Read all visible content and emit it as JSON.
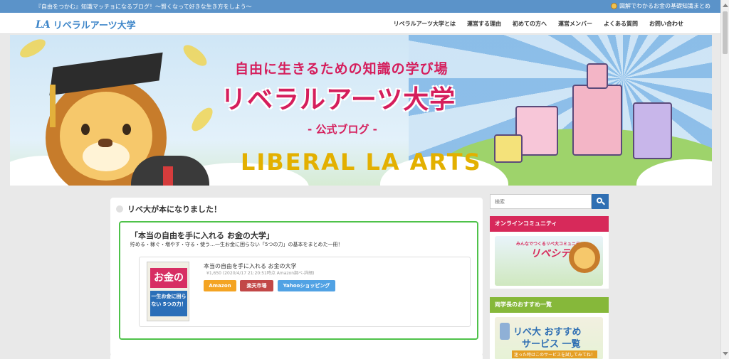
{
  "topbar": {
    "tagline": "『自由をつかむ』知識マッチョになるブログ！〜賢くなって好きな生き方をしよう〜",
    "right_link": "図解でわかるお金の基礎知識まとめ"
  },
  "header": {
    "logo_mark": "LA",
    "logo_text": "リベラルアーツ大学",
    "nav": [
      "リベラルアーツ大学とは",
      "運営する理由",
      "初めての方へ",
      "運営メンバー",
      "よくある質問",
      "お問い合わせ"
    ]
  },
  "hero": {
    "subtitle": "自由に生きるための知識の学び場",
    "title": "リベラルアーツ大学",
    "blog": "- 公式ブログ -",
    "brand": "LIBERAL LA ARTS"
  },
  "main": {
    "heading": "リベ大が本になりました！",
    "book_title": "「本当の自由を手に入れる お金の大学」",
    "book_desc": "貯める・稼ぐ・増やす・守る・使う…一生お金に困らない「5つの力」の基本をまとめた一冊！",
    "cover_title": "お金の大学",
    "cover_sub": "一生お金に困らない 5つの力！",
    "product_name": "本当の自由を手に入れる お金の大学",
    "product_price": "¥1,650 (2020/4/17 21:20:51時点 Amazon調べ-詳細)",
    "buttons": {
      "amazon": "Amazon",
      "rakuten": "楽天市場",
      "yahoo": "Yahooショッピング"
    }
  },
  "sidebar": {
    "search_placeholder": "検索",
    "widget1_title": "オンラインコミュニティ",
    "widget1_banner_sub": "みんなでつくるリベ大コミュニティ",
    "widget1_banner_logo": "リベシティ",
    "widget2_title": "両学長のおすすめ一覧",
    "widget2_banner_line1": "リベ大 おすすめ",
    "widget2_banner_line2": "サービス 一覧",
    "widget2_banner_line3": "迷った時はこのサービスを試してみてね！"
  },
  "colors": {
    "topbar": "#5b93c9",
    "brand_blue": "#3e86c9",
    "hero_pink": "#d51e5c",
    "hero_gold": "#e3b000",
    "green_border": "#4fc24a",
    "widget_pink": "#d7295a",
    "widget_green": "#86b83a",
    "amazon": "#f4a423",
    "rakuten": "#c24747",
    "yahoo": "#51a2e4"
  },
  "icons": {
    "search": "search-icon",
    "lion": "lion-mascot-icon",
    "bullet": "circle-bullet-icon"
  }
}
